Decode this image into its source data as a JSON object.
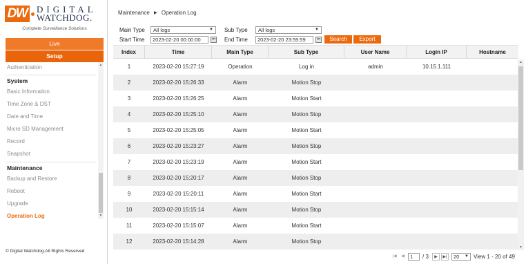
{
  "brand": {
    "logo_mark": "DW",
    "logo_line1": "DIGITAL",
    "logo_line2": "WATCHDOG.",
    "tagline": "Complete Surveillance Solutions"
  },
  "nav": {
    "live": "Live",
    "setup": "Setup"
  },
  "menu": {
    "top_item": "Authentication",
    "system": {
      "title": "System",
      "items": [
        "Basic Information",
        "Time Zone & DST",
        "Date and Time",
        "Micro SD Management",
        "Record",
        "Snapshot"
      ]
    },
    "maintenance": {
      "title": "Maintenance",
      "items": [
        "Backup and Restore",
        "Reboot",
        "Upgrade",
        "Operation Log"
      ]
    }
  },
  "copyright": "© Digital Watchdog.All Rights Reserved",
  "breadcrumb": {
    "section": "Maintenance",
    "separator": "▶",
    "page": "Operation Log"
  },
  "filters": {
    "main_type_label": "Main Type",
    "main_type_value": "All logs",
    "sub_type_label": "Sub Type",
    "sub_type_value": "All logs",
    "start_time_label": "Start Time",
    "start_time_value": "2023-02-20 00:00:00",
    "end_time_label": "End Time",
    "end_time_value": "2023-02-20 23:59:59",
    "search_label": "Search",
    "export_label": "Export"
  },
  "table": {
    "columns": [
      "Index",
      "Time",
      "Main Type",
      "Sub Type",
      "User Name",
      "Login IP",
      "Hostname"
    ],
    "rows": [
      [
        "1",
        "2023-02-20 15:27:19",
        "Operation",
        "Log in",
        "admin",
        "10.15.1.111",
        ""
      ],
      [
        "2",
        "2023-02-20 15:26:33",
        "Alarm",
        "Motion Stop",
        "",
        "",
        ""
      ],
      [
        "3",
        "2023-02-20 15:26:25",
        "Alarm",
        "Motion Start",
        "",
        "",
        ""
      ],
      [
        "4",
        "2023-02-20 15:25:10",
        "Alarm",
        "Motion Stop",
        "",
        "",
        ""
      ],
      [
        "5",
        "2023-02-20 15:25:05",
        "Alarm",
        "Motion Start",
        "",
        "",
        ""
      ],
      [
        "6",
        "2023-02-20 15:23:27",
        "Alarm",
        "Motion Stop",
        "",
        "",
        ""
      ],
      [
        "7",
        "2023-02-20 15:23:19",
        "Alarm",
        "Motion Start",
        "",
        "",
        ""
      ],
      [
        "8",
        "2023-02-20 15:20:17",
        "Alarm",
        "Motion Stop",
        "",
        "",
        ""
      ],
      [
        "9",
        "2023-02-20 15:20:11",
        "Alarm",
        "Motion Start",
        "",
        "",
        ""
      ],
      [
        "10",
        "2023-02-20 15:15:14",
        "Alarm",
        "Motion Stop",
        "",
        "",
        ""
      ],
      [
        "11",
        "2023-02-20 15:15:07",
        "Alarm",
        "Motion Start",
        "",
        "",
        ""
      ],
      [
        "12",
        "2023-02-20 15:14:28",
        "Alarm",
        "Motion Stop",
        "",
        "",
        ""
      ]
    ]
  },
  "pager": {
    "first": "|◀",
    "prev": "◀",
    "current_page": "1",
    "total_pages": "/ 3",
    "next": "▶",
    "last": "▶|",
    "page_size": "20",
    "summary": "View 1 - 20 of 49"
  },
  "icons": {
    "dropdown": "chevron-down-icon",
    "calendar": "calendar-icon",
    "scroll_up": "scroll-up-arrow-icon",
    "scroll_down": "scroll-down-arrow-icon"
  },
  "colors": {
    "accent": "#ec6a0e",
    "row_alt": "#eeeeee",
    "header_bg": "#f2f2f2"
  }
}
